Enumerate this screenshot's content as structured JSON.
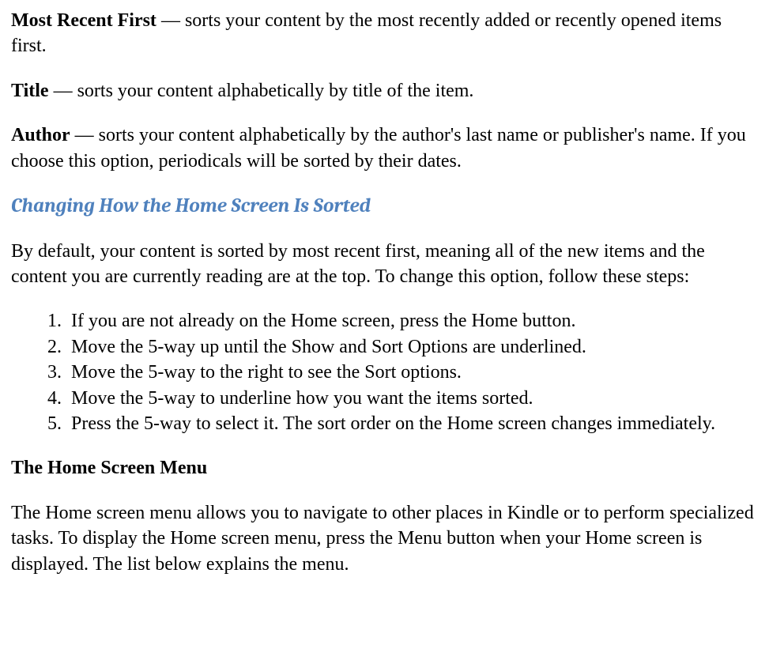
{
  "definitions": [
    {
      "term": "Most Recent First",
      "sep": " — ",
      "desc": "sorts your content by the most recently added or recently opened items first."
    },
    {
      "term": "Title",
      "sep": " — ",
      "desc": "sorts your content alphabetically by title of the item."
    },
    {
      "term": "Author",
      "sep": " — ",
      "desc": "sorts your content alphabetically by the author's last name or publisher's name. If you choose this option, periodicals will be sorted by their dates."
    }
  ],
  "heading_blue": "Changing How the Home Screen Is Sorted",
  "intro": "By default, your content is sorted by most recent first, meaning all of the new items and the content you are currently reading are at the top. To change this option, follow these steps:",
  "steps": [
    "If you are not already on the Home screen, press the Home button.",
    "Move the 5-way up until the Show and Sort Options are underlined.",
    "Move the 5-way to the right to see the Sort options.",
    "Move the 5-way to underline how you want the items sorted.",
    "Press the 5-way to select it. The sort order on the Home screen changes immediately."
  ],
  "heading_bold": "The Home Screen Menu",
  "menu_desc": "The Home screen menu allows you to navigate to other places in Kindle or to perform specialized tasks. To display the Home screen menu, press the Menu button when your Home screen is displayed. The list below explains the menu."
}
